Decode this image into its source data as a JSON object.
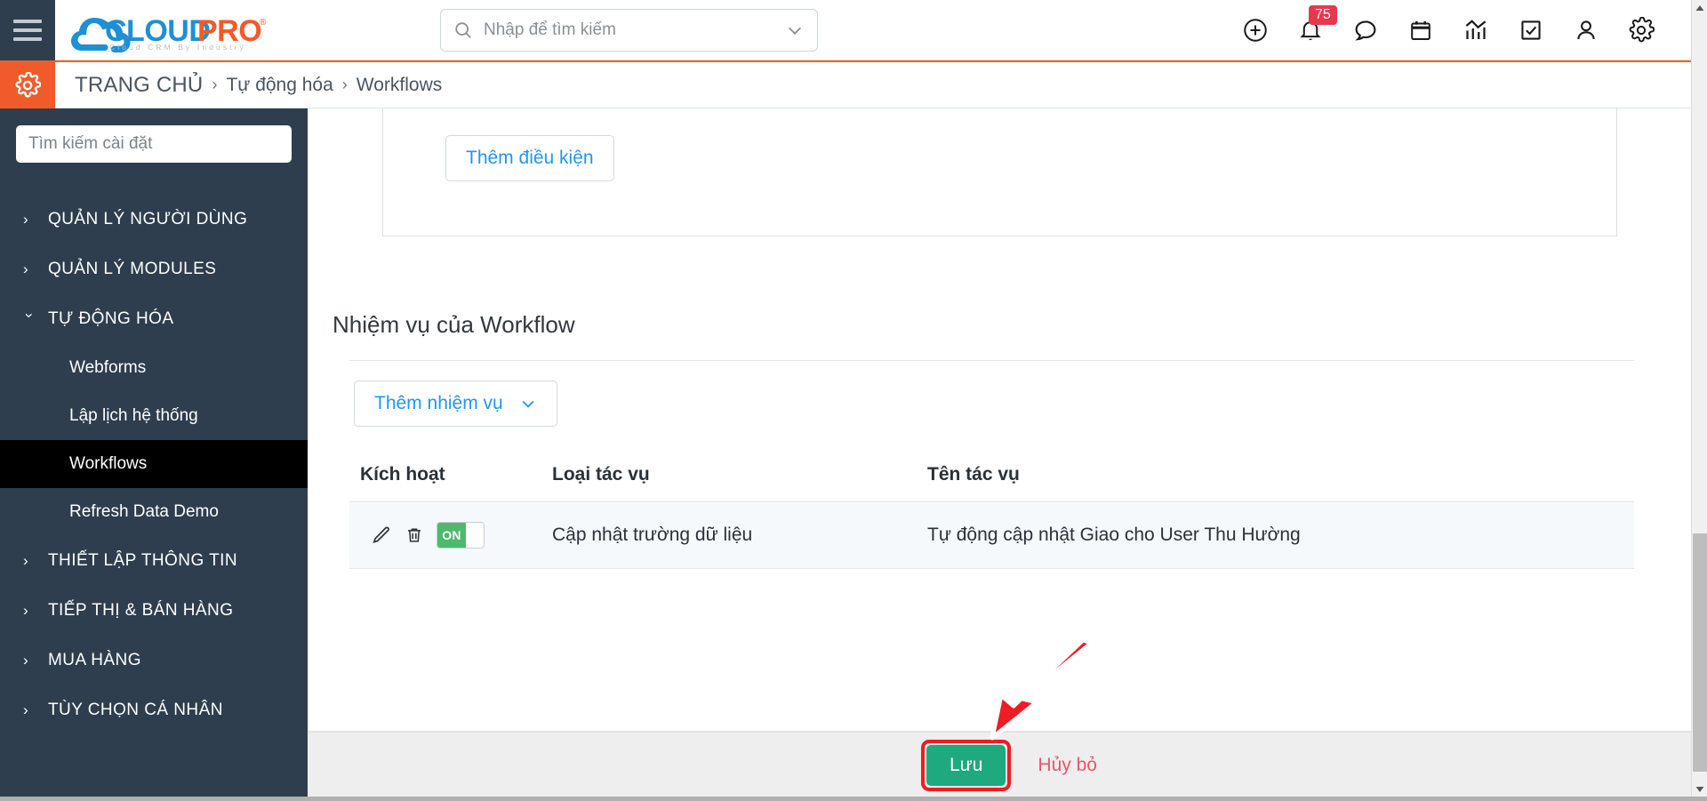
{
  "app": {
    "brand_name": "CLOUDPRO",
    "brand_tagline": "Cloud CRM By Industry",
    "brand_cloud_color": "#1f8fd6",
    "brand_pro_color": "#f15a29",
    "accent_orange": "#f15a29",
    "sidebar_bg": "#2e3e4e",
    "link_blue": "#2196f3",
    "save_green": "#1fa97f",
    "toggle_green": "#4cbb6c",
    "danger_red": "#e8566c",
    "annotation_red": "#ee1c25"
  },
  "header": {
    "menu_icon": "hamburger-menu-icon",
    "search": {
      "placeholder": "Nhập để tìm kiếm",
      "value": "",
      "icon": "search-icon",
      "dropdown_icon": "chevron-down-icon"
    },
    "icons": [
      {
        "name": "add-circle-icon",
        "label": "Thêm mới",
        "badge": ""
      },
      {
        "name": "bell-icon",
        "label": "Thông báo",
        "badge": "75"
      },
      {
        "name": "chat-bubble-icon",
        "label": "Tin nhắn",
        "badge": ""
      },
      {
        "name": "calendar-icon",
        "label": "Lịch",
        "badge": ""
      },
      {
        "name": "chart-icon",
        "label": "Báo cáo",
        "badge": ""
      },
      {
        "name": "checkbox-icon",
        "label": "Công việc",
        "badge": ""
      },
      {
        "name": "person-icon",
        "label": "Tài khoản",
        "badge": ""
      },
      {
        "name": "gear-icon",
        "label": "Cài đặt",
        "badge": ""
      }
    ]
  },
  "breadcrumb": {
    "settings_icon": "gear-icon",
    "separator": "›",
    "items": [
      {
        "label": "TRANG CHỦ",
        "is_home": true
      },
      {
        "label": "Tự động hóa",
        "is_home": false
      },
      {
        "label": "Workflows",
        "is_home": false
      }
    ]
  },
  "sidebar": {
    "search": {
      "placeholder": "Tìm kiếm cài đặt",
      "value": ""
    },
    "items": [
      {
        "label": "QUẢN LÝ NGƯỜI DÙNG",
        "type": "group",
        "expanded": false,
        "chevron": "chevron-right-icon"
      },
      {
        "label": "QUẢN LÝ MODULES",
        "type": "group",
        "expanded": false,
        "chevron": "chevron-right-icon"
      },
      {
        "label": "TỰ ĐỘNG HÓA",
        "type": "group",
        "expanded": true,
        "chevron": "chevron-down-icon"
      },
      {
        "label": "Webforms",
        "type": "sub",
        "active": false
      },
      {
        "label": "Lập lịch hệ thống",
        "type": "sub",
        "active": false
      },
      {
        "label": "Workflows",
        "type": "sub",
        "active": true
      },
      {
        "label": "Refresh Data Demo",
        "type": "sub",
        "active": false
      },
      {
        "label": "THIẾT LẬP THÔNG TIN",
        "type": "group",
        "expanded": false,
        "chevron": "chevron-right-icon"
      },
      {
        "label": "TIẾP THỊ & BÁN HÀNG",
        "type": "group",
        "expanded": false,
        "chevron": "chevron-right-icon"
      },
      {
        "label": "MUA HÀNG",
        "type": "group",
        "expanded": false,
        "chevron": "chevron-right-icon"
      },
      {
        "label": "TÙY CHỌN CÁ NHÂN",
        "type": "group",
        "expanded": false,
        "chevron": "chevron-right-icon"
      }
    ]
  },
  "main": {
    "conditions_panel": {
      "add_condition_label": "Thêm điều kiện"
    },
    "tasks_section": {
      "title": "Nhiệm vụ của Workflow",
      "add_task_label": "Thêm nhiệm vụ",
      "add_task_caret": "chevron-down-icon",
      "table": {
        "columns": [
          "Kích hoạt",
          "Loại tác vụ",
          "Tên tác vụ"
        ],
        "rows": [
          {
            "edit_icon": "pencil-icon",
            "delete_icon": "trash-icon",
            "toggle_state": "ON",
            "task_type": "Cập nhật trường dữ liệu",
            "task_name": "Tự động cập nhật Giao cho User Thu Hường"
          }
        ]
      }
    }
  },
  "footer": {
    "save_label": "Lưu",
    "cancel_label": "Hủy bỏ",
    "annotation": {
      "arrow": "red-arrow-pointing-to-save",
      "highlight": "red-rectangle-around-save-button"
    }
  },
  "scrollbar": {
    "vertical_up_icon": "triangle-up-icon",
    "vertical_down_icon": "triangle-down-icon"
  }
}
